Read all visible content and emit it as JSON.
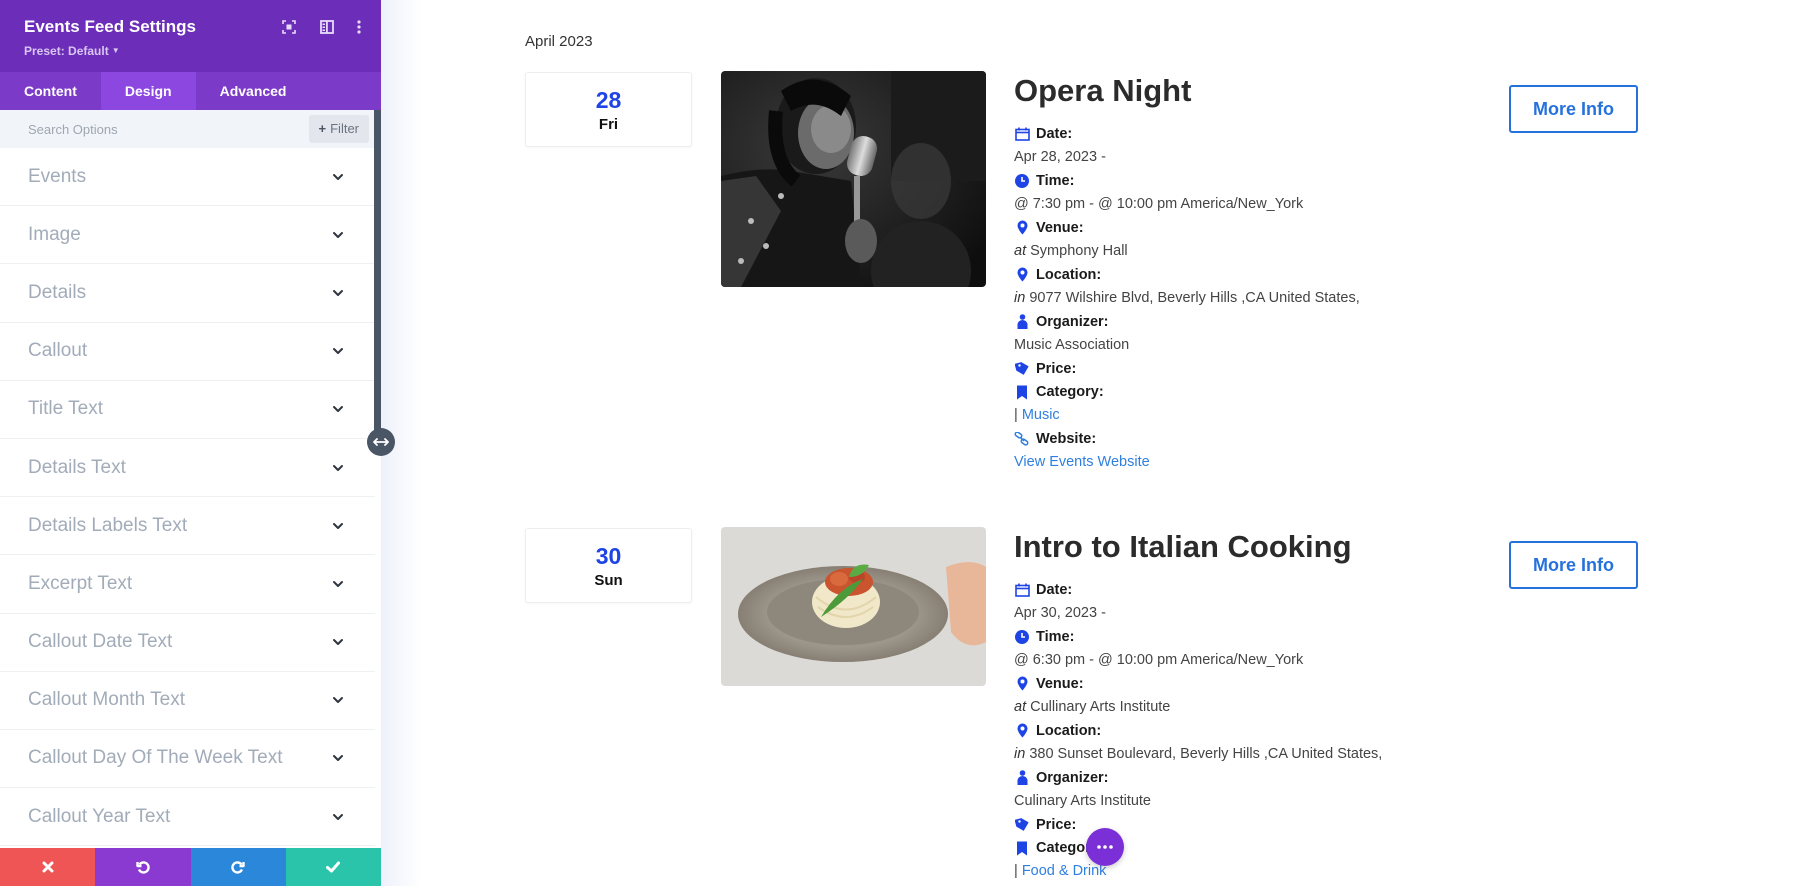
{
  "panel": {
    "title": "Events Feed Settings",
    "preset_label": "Preset: Default",
    "header_icons": [
      "focus-mode-icon",
      "split-view-icon",
      "more-vertical-icon"
    ],
    "tabs": [
      {
        "label": "Content",
        "active": false
      },
      {
        "label": "Design",
        "active": true
      },
      {
        "label": "Advanced",
        "active": false
      }
    ],
    "search": {
      "placeholder": "Search Options",
      "value": ""
    },
    "filter_label": "Filter",
    "sections": [
      {
        "label": "Events"
      },
      {
        "label": "Image"
      },
      {
        "label": "Details"
      },
      {
        "label": "Callout"
      },
      {
        "label": "Title Text"
      },
      {
        "label": "Details Text"
      },
      {
        "label": "Details Labels Text"
      },
      {
        "label": "Excerpt Text"
      },
      {
        "label": "Callout Date Text"
      },
      {
        "label": "Callout Month Text"
      },
      {
        "label": "Callout Day Of The Week Text"
      },
      {
        "label": "Callout Year Text"
      }
    ],
    "footer_buttons": [
      {
        "action": "discard",
        "icon": "close-icon",
        "color": "#ef5555"
      },
      {
        "action": "undo",
        "icon": "undo-icon",
        "color": "#8a3ad0"
      },
      {
        "action": "redo",
        "icon": "redo-icon",
        "color": "#2b87da"
      },
      {
        "action": "save",
        "icon": "check-icon",
        "color": "#29c4a9"
      }
    ],
    "colors": {
      "header": "#6c2eb9",
      "tabs": "#7c3ac9",
      "active_tab": "#8c47e0"
    }
  },
  "feed": {
    "month_label": "April 2023",
    "events": [
      {
        "callout_day": "28",
        "callout_dow": "Fri",
        "image_alt": "Singer performing with vintage microphone (black and white)",
        "title": "Opera Night",
        "more_info_label": "More Info",
        "details": {
          "date_label": "Date:",
          "date_value": "Apr 28, 2023 -",
          "time_label": "Time:",
          "time_value": "@ 7:30 pm - @ 10:00 pm America/New_York",
          "venue_label": "Venue:",
          "venue_prefix": "at",
          "venue_value": "Symphony Hall",
          "location_label": "Location:",
          "location_prefix": "in",
          "location_value": "9077 Wilshire Blvd, Beverly Hills ,CA United States,",
          "organizer_label": "Organizer:",
          "organizer_value": "Music Association",
          "price_label": "Price:",
          "category_label": "Category:",
          "category_sep": "|",
          "category_value": "Music",
          "website_label": "Website:",
          "website_value": "View Events Website"
        }
      },
      {
        "callout_day": "30",
        "callout_dow": "Sun",
        "image_alt": "Plate of spaghetti with tomato sauce and basil",
        "title": "Intro to Italian Cooking",
        "more_info_label": "More Info",
        "details": {
          "date_label": "Date:",
          "date_value": "Apr 30, 2023 -",
          "time_label": "Time:",
          "time_value": "@ 6:30 pm - @ 10:00 pm America/New_York",
          "venue_label": "Venue:",
          "venue_prefix": "at",
          "venue_value": "Cullinary Arts Institute",
          "location_label": "Location:",
          "location_prefix": "in",
          "location_value": "380 Sunset Boulevard, Beverly Hills ,CA United States,",
          "organizer_label": "Organizer:",
          "organizer_value": "Culinary Arts Institute",
          "price_label": "Price:",
          "category_label": "Category:",
          "category_sep": "|",
          "category_value": "Food & Drink"
        }
      }
    ],
    "colors": {
      "accent": "#1e44e6",
      "link": "#2e7fe0",
      "button": "#2672dd",
      "fab": "#7b2fd6"
    }
  }
}
